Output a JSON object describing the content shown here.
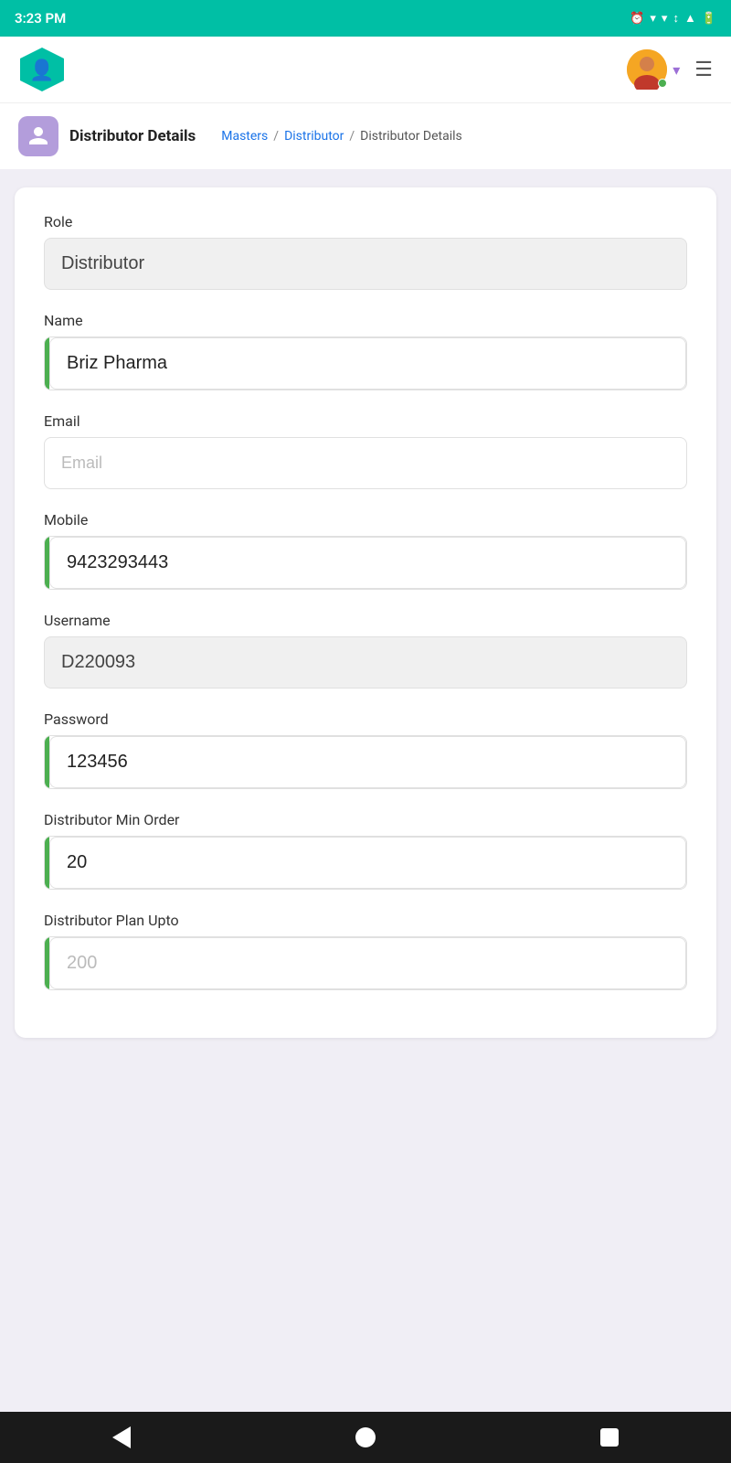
{
  "statusBar": {
    "time": "3:23 PM"
  },
  "appBar": {
    "menuLabel": "Menu"
  },
  "breadcrumb": {
    "pageTitle": "Distributor Details",
    "links": [
      {
        "label": "Masters",
        "href": "#"
      },
      {
        "label": "Distributor",
        "href": "#"
      },
      {
        "label": "Distributor Details"
      }
    ]
  },
  "form": {
    "fields": [
      {
        "id": "role",
        "label": "Role",
        "value": "Distributor",
        "placeholder": "",
        "readonly": true,
        "greenBar": false
      },
      {
        "id": "name",
        "label": "Name",
        "value": "Briz Pharma",
        "placeholder": "",
        "readonly": false,
        "greenBar": true
      },
      {
        "id": "email",
        "label": "Email",
        "value": "",
        "placeholder": "Email",
        "readonly": false,
        "greenBar": false
      },
      {
        "id": "mobile",
        "label": "Mobile",
        "value": "9423293443",
        "placeholder": "",
        "readonly": false,
        "greenBar": true
      },
      {
        "id": "username",
        "label": "Username",
        "value": "D220093",
        "placeholder": "",
        "readonly": true,
        "greenBar": false
      },
      {
        "id": "password",
        "label": "Password",
        "value": "123456",
        "placeholder": "",
        "readonly": false,
        "greenBar": true
      },
      {
        "id": "dist-min-order",
        "label": "Distributor Min Order",
        "value": "20",
        "placeholder": "",
        "readonly": false,
        "greenBar": true
      },
      {
        "id": "dist-plan-upto",
        "label": "Distributor Plan Upto",
        "value": "200",
        "placeholder": "",
        "readonly": false,
        "greenBar": true
      }
    ]
  }
}
